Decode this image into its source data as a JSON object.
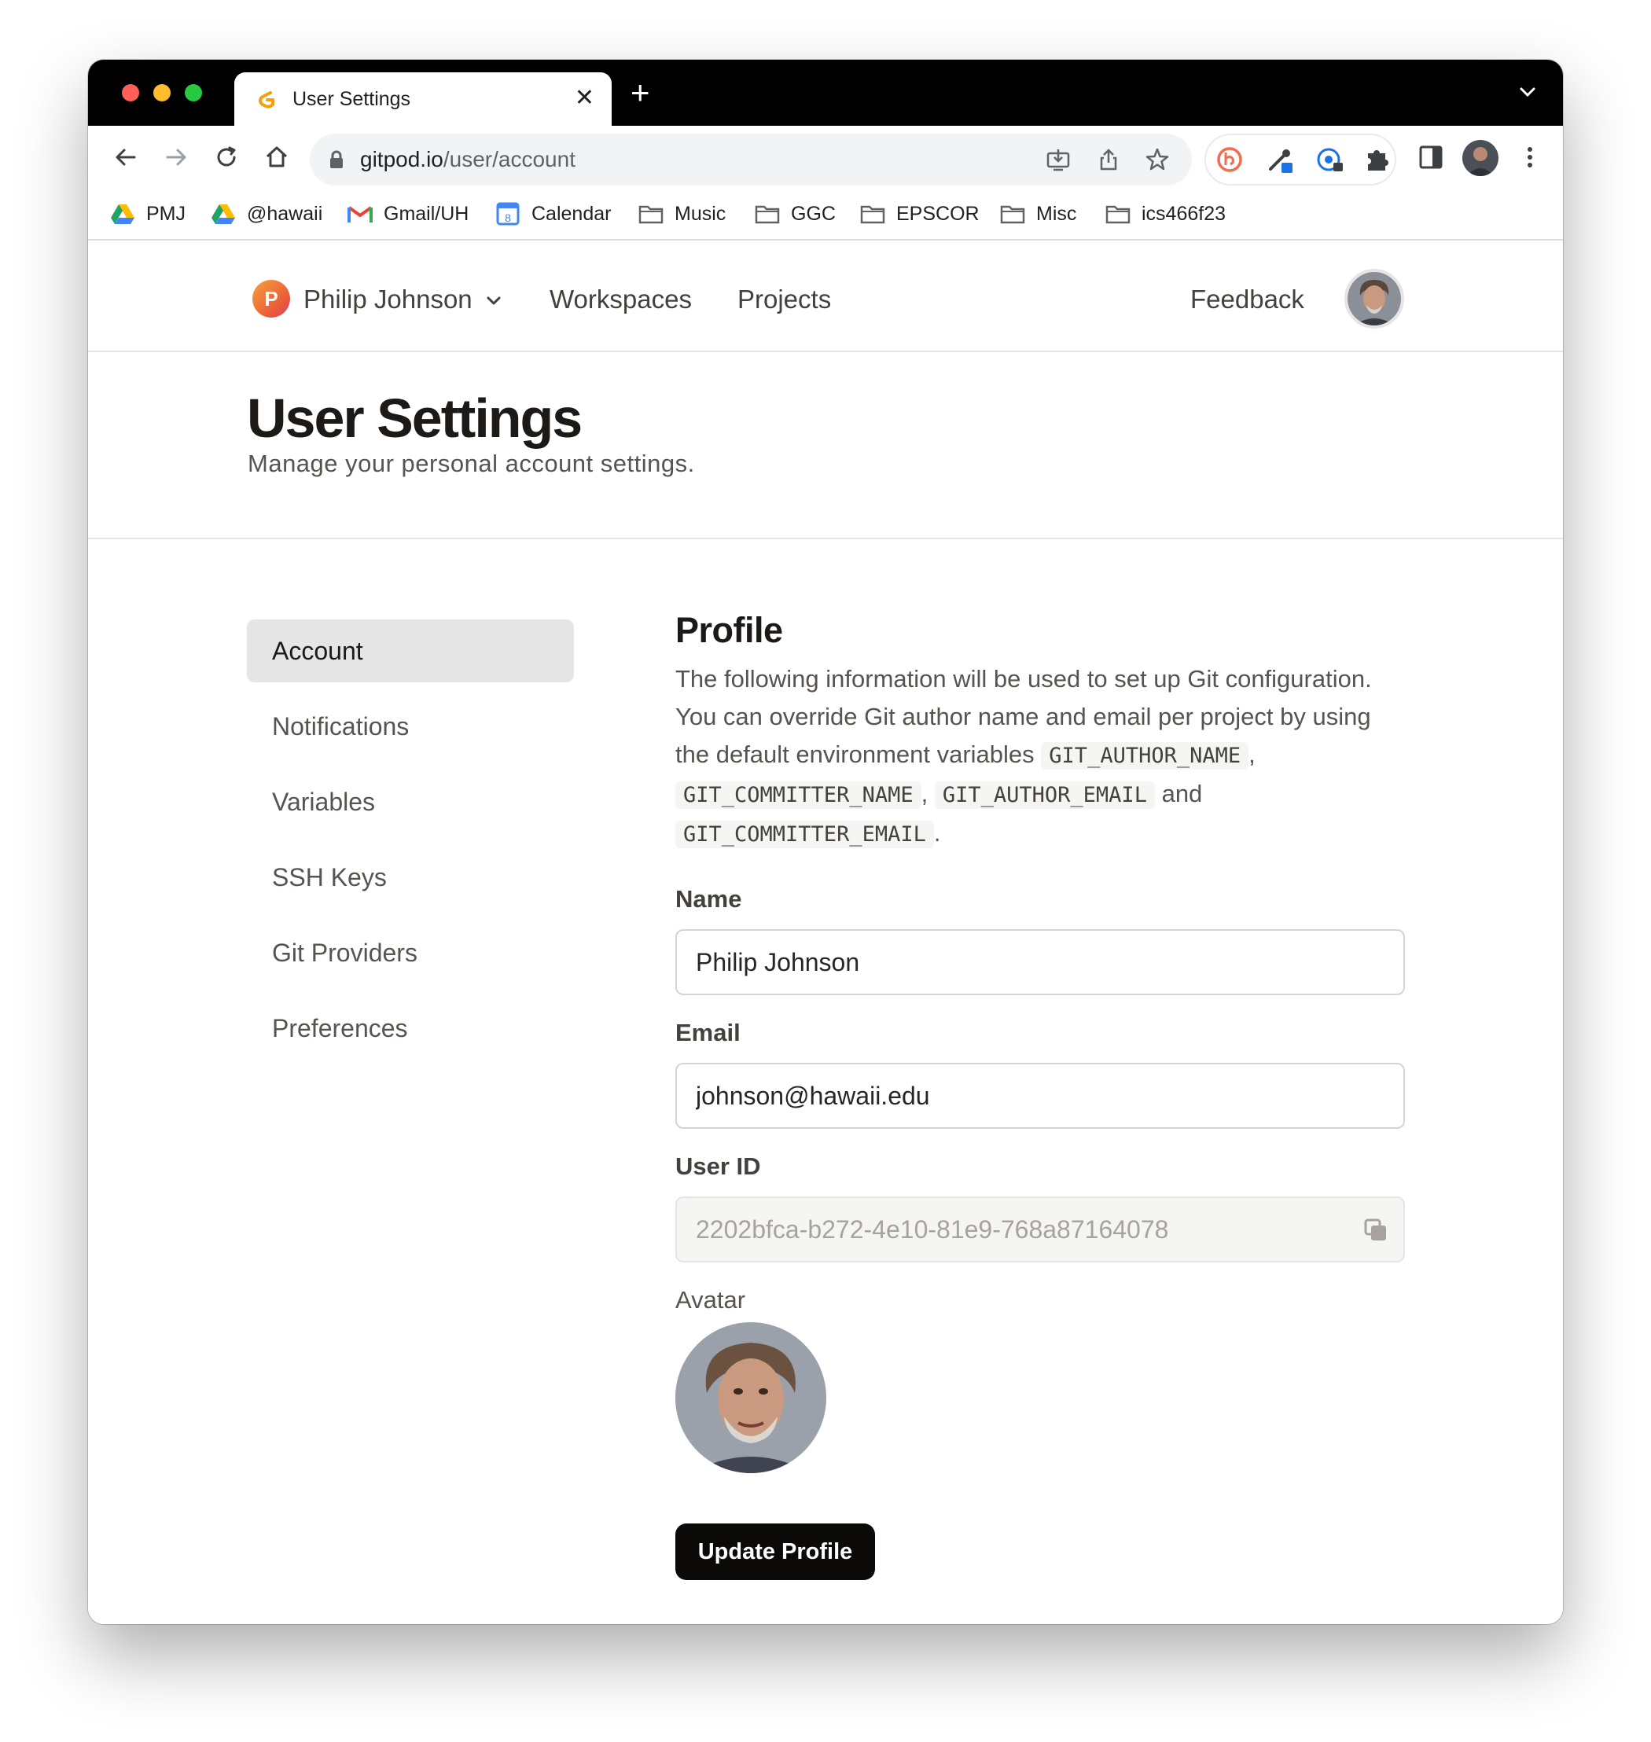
{
  "browser": {
    "tab_title": "User Settings",
    "url_host": "gitpod.io",
    "url_path": "/user/account",
    "bookmarks": [
      {
        "label": "PMJ",
        "icon": "google-drive-icon"
      },
      {
        "label": "@hawaii",
        "icon": "google-drive-icon"
      },
      {
        "label": "Gmail/UH",
        "icon": "gmail-icon"
      },
      {
        "label": "Calendar",
        "icon": "calendar-icon"
      },
      {
        "label": "Music",
        "icon": "folder-icon"
      },
      {
        "label": "GGC",
        "icon": "folder-icon"
      },
      {
        "label": "EPSCOR",
        "icon": "folder-icon"
      },
      {
        "label": "Misc",
        "icon": "folder-icon"
      },
      {
        "label": "ics466f23",
        "icon": "folder-icon"
      }
    ]
  },
  "topnav": {
    "org_initial": "P",
    "org_name": "Philip Johnson",
    "links": [
      "Workspaces",
      "Projects"
    ],
    "feedback": "Feedback"
  },
  "header": {
    "title": "User Settings",
    "subtitle": "Manage your personal account settings."
  },
  "sidebar": {
    "items": [
      {
        "label": "Account",
        "active": true
      },
      {
        "label": "Notifications",
        "active": false
      },
      {
        "label": "Variables",
        "active": false
      },
      {
        "label": "SSH Keys",
        "active": false
      },
      {
        "label": "Git Providers",
        "active": false
      },
      {
        "label": "Preferences",
        "active": false
      }
    ]
  },
  "profile": {
    "title": "Profile",
    "description_intro": "The following information will be used to set up Git configuration. You can override Git author name and email per project by using the default environment variables",
    "env_vars": [
      "GIT_AUTHOR_NAME",
      "GIT_COMMITTER_NAME",
      "GIT_AUTHOR_EMAIL",
      "GIT_COMMITTER_EMAIL"
    ],
    "sep_comma": ",",
    "sep_and": "and",
    "sep_period": ".",
    "name_label": "Name",
    "name_value": "Philip Johnson",
    "email_label": "Email",
    "email_value": "johnson@hawaii.edu",
    "userid_label": "User ID",
    "userid_value": "2202bfca-b272-4e10-81e9-768a87164078",
    "avatar_label": "Avatar",
    "update_button": "Update Profile"
  },
  "colors": {
    "accent_dark": "#0c0a09",
    "active_nav_bg": "#e5e5e5",
    "org_avatar_gradient_start": "#f7a23b",
    "org_avatar_gradient_end": "#d9436d"
  }
}
